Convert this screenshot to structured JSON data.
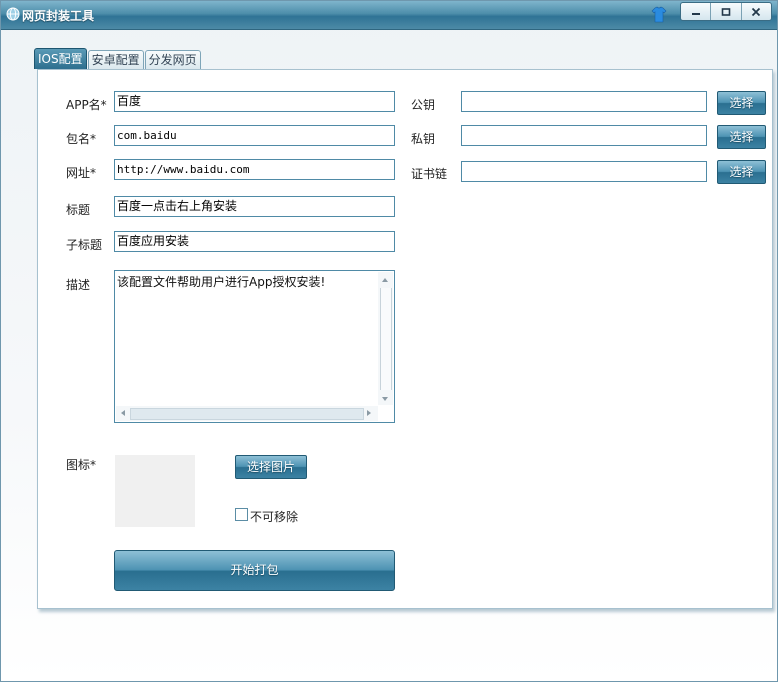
{
  "window": {
    "title": "网页封装工具",
    "controls": [
      "minimize",
      "maximize",
      "close"
    ]
  },
  "tabs": [
    {
      "label": "IOS配置",
      "active": true
    },
    {
      "label": "安卓配置",
      "active": false
    },
    {
      "label": "分发网页",
      "active": false
    }
  ],
  "form": {
    "app_name": {
      "label": "APP名*",
      "value": "百度"
    },
    "package": {
      "label": "包名*",
      "value": "com.baidu"
    },
    "url": {
      "label": "网址*",
      "value": "http://www.baidu.com"
    },
    "title": {
      "label": "标题",
      "value": "百度一点击右上角安装"
    },
    "subtitle": {
      "label": "子标题",
      "value": "百度应用安装"
    },
    "description": {
      "label": "描述",
      "value": "该配置文件帮助用户进行App授权安装!"
    },
    "icon": {
      "label": "图标*",
      "choose_button": "选择图片"
    },
    "non_removable": {
      "label": "不可移除",
      "checked": false
    },
    "build_button": "开始打包"
  },
  "certs": {
    "public_key": {
      "label": "公钥",
      "value": "",
      "button": "选择"
    },
    "private_key": {
      "label": "私钥",
      "value": "",
      "button": "选择"
    },
    "cert_chain": {
      "label": "证书链",
      "value": "",
      "button": "选择"
    }
  },
  "colors": {
    "title_bar": "#2f7395",
    "button": "#3c82a3",
    "field_border": "#4f8aa6"
  }
}
